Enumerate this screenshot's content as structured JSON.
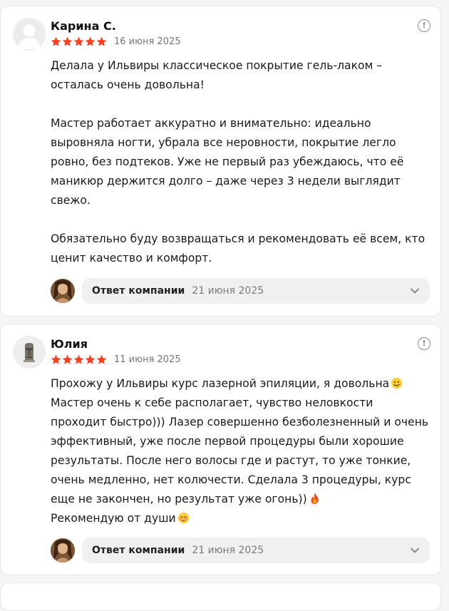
{
  "reviews": [
    {
      "author": "Карина С.",
      "rating": 5,
      "date": "16 июня 2025",
      "avatar_icon": "default-user-avatar",
      "paragraphs": [
        "Делала у Ильвиры классическое покрытие гель-лаком – осталась очень довольна!",
        "Мастер работает аккуратно и внимательно: идеально выровняла ногти, убрала все неровности, покрытие легло ровно, без подтеков. Уже не первый раз убеждаюсь, что её маникюр держится долго – даже через 3 недели выглядит свежо.",
        "Обязательно буду возвращаться и рекомендовать её всем, кто ценит качество и комфорт."
      ],
      "reply": {
        "label": "Ответ компании",
        "date": "21 июня 2025"
      }
    },
    {
      "author": "Юлия",
      "rating": 5,
      "date": "11 июня 2025",
      "avatar_icon": "moai-statue-avatar",
      "text_parts": [
        "Прохожу у Ильвиры курс лазерной эпиляции, я довольна",
        "Мастер очень к себе располагает, чувство неловкости проходит быстро))) Лазер совершенно безболезненный и очень эффективный, уже после первой процедуры были хорошие результаты. После него волосы где и растут, то уже тонкие, очень медленно, нет колючести. Сделала 3 процедуры, курс еще не закончен, но результат уже огонь))",
        "Рекомендую от души"
      ],
      "emojis": [
        "smiling-face-emoji",
        "fire-emoji",
        "relieved-face-emoji"
      ],
      "reply": {
        "label": "Ответ компании",
        "date": "21 июня 2025"
      }
    }
  ],
  "colors": {
    "star": "#fc3f1d",
    "info_icon": "#8c8c8c",
    "reply_bg": "#f0f0f0"
  }
}
